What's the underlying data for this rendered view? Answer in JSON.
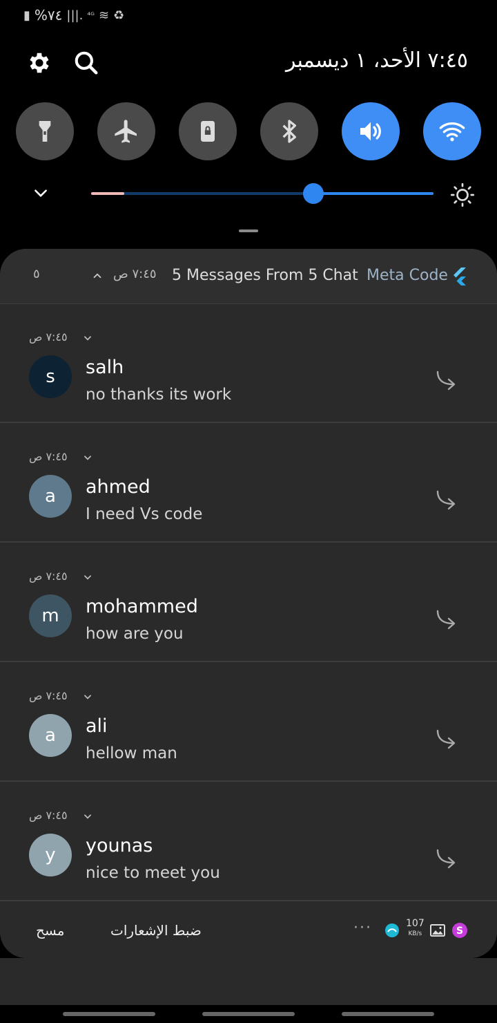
{
  "status_bar": {
    "battery_text": "%٧٤"
  },
  "header": {
    "datetime": "٧:٤٥  الأحد، ١ ديسمبر"
  },
  "quick_toggles": [
    {
      "name": "flashlight",
      "icon": "flashlight-icon",
      "active": false
    },
    {
      "name": "airplane-mode",
      "icon": "airplane-icon",
      "active": false
    },
    {
      "name": "screen-lock",
      "icon": "lock-rotation-icon",
      "active": false
    },
    {
      "name": "bluetooth",
      "icon": "bluetooth-icon",
      "active": false
    },
    {
      "name": "sound",
      "icon": "volume-icon",
      "active": true
    },
    {
      "name": "wifi",
      "icon": "wifi-icon",
      "active": true
    }
  ],
  "brightness": {
    "level": 0.65
  },
  "notification_group": {
    "app_name": "Meta Code",
    "title": "5 Messages From 5 Chat",
    "time": "٧:٤٥ ص",
    "count": "٥"
  },
  "notifications": [
    {
      "time": "٧:٤٥ ص",
      "initial": "s",
      "name": "salh",
      "message": "no thanks its work",
      "avatar_color": "#0d2233"
    },
    {
      "time": "٧:٤٥ ص",
      "initial": "a",
      "name": "ahmed",
      "message": "I need Vs code",
      "avatar_color": "#5f7a8c"
    },
    {
      "time": "٧:٤٥ ص",
      "initial": "m",
      "name": "mohammed",
      "message": "how are you",
      "avatar_color": "#3e5563"
    },
    {
      "time": "٧:٤٥ ص",
      "initial": "a",
      "name": "ali",
      "message": "hellow man",
      "avatar_color": "#90a4ae"
    },
    {
      "time": "٧:٤٥ ص",
      "initial": "y",
      "name": "younas",
      "message": "nice to meet you",
      "avatar_color": "#90a4ae"
    }
  ],
  "footer": {
    "clear_label": "مسح",
    "settings_label": "ضبط الإشعارات",
    "more_label": "···",
    "net_speed": "107",
    "net_unit": "KB/s"
  },
  "colors": {
    "accent": "#3f8ef5",
    "panel_bg": "#2a2a2a"
  }
}
